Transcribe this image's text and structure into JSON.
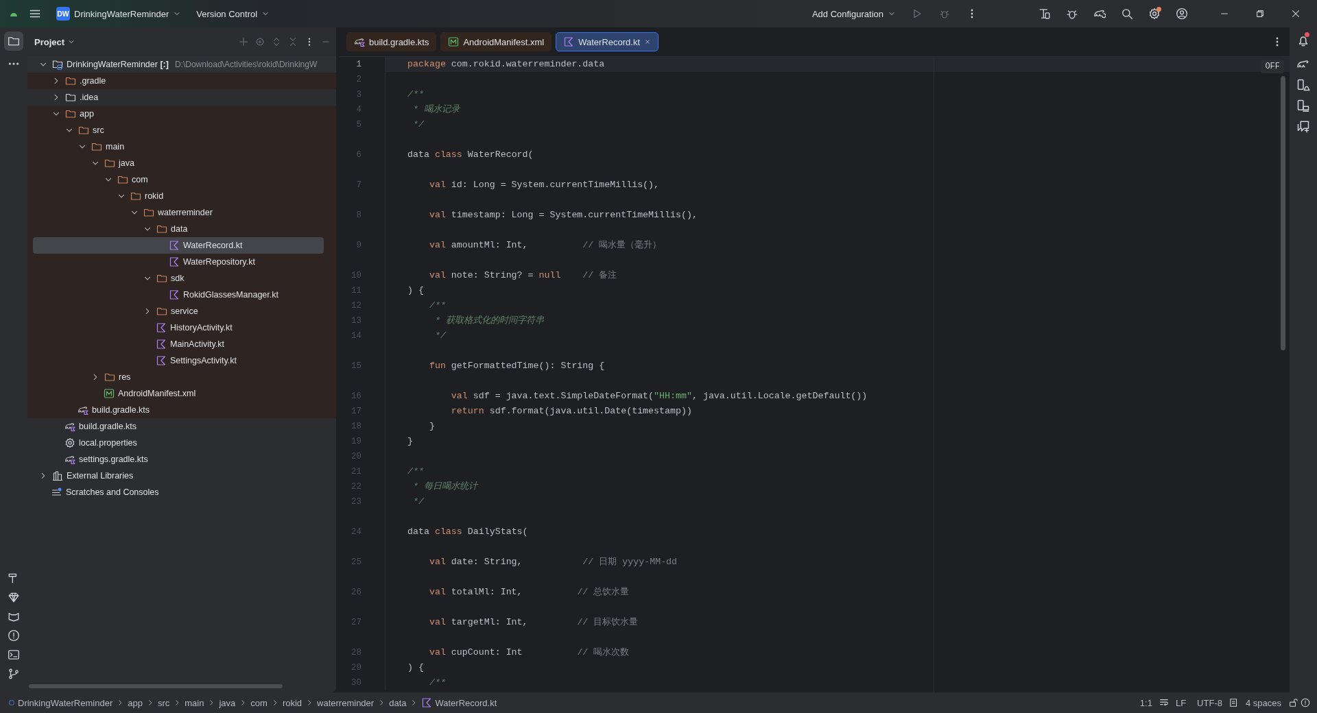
{
  "title_bar": {
    "project_badge": "DW",
    "project_name": "DrinkingWaterReminder",
    "vcs": "Version Control",
    "run_config": "Add Configuration"
  },
  "project_panel": {
    "title": "Project",
    "tree": [
      {
        "label": "DrinkingWaterReminder **[:]**",
        "path": "D:\\Download\\Activities\\rokid\\DrinkingW",
        "kind": "module",
        "expanded": true,
        "tinted": false,
        "selected": false,
        "children": [
          {
            "label": ".gradle",
            "kind": "folder",
            "expanded": false,
            "tinted": true,
            "selected": false
          },
          {
            "label": ".idea",
            "kind": "folder-plain",
            "expanded": false,
            "tinted": false,
            "selected": false
          },
          {
            "label": "app",
            "kind": "folder",
            "expanded": true,
            "tinted": true,
            "selected": false,
            "children": [
              {
                "label": "src",
                "kind": "folder",
                "expanded": true,
                "tinted": true,
                "selected": false,
                "children": [
                  {
                    "label": "main",
                    "kind": "folder",
                    "expanded": true,
                    "tinted": true,
                    "selected": false,
                    "children": [
                      {
                        "label": "java",
                        "kind": "folder",
                        "expanded": true,
                        "tinted": true,
                        "selected": false,
                        "children": [
                          {
                            "label": "com",
                            "kind": "folder",
                            "expanded": true,
                            "tinted": true,
                            "selected": false,
                            "children": [
                              {
                                "label": "rokid",
                                "kind": "folder",
                                "expanded": true,
                                "tinted": true,
                                "selected": false,
                                "children": [
                                  {
                                    "label": "waterreminder",
                                    "kind": "folder",
                                    "expanded": true,
                                    "tinted": true,
                                    "selected": false,
                                    "children": [
                                      {
                                        "label": "data",
                                        "kind": "folder",
                                        "expanded": true,
                                        "tinted": true,
                                        "selected": false,
                                        "children": [
                                          {
                                            "label": "WaterRecord.kt",
                                            "kind": "kotlin",
                                            "tinted": true,
                                            "selected": true
                                          },
                                          {
                                            "label": "WaterRepository.kt",
                                            "kind": "kotlin",
                                            "tinted": true,
                                            "selected": false
                                          }
                                        ]
                                      },
                                      {
                                        "label": "sdk",
                                        "kind": "folder",
                                        "expanded": true,
                                        "tinted": true,
                                        "selected": false,
                                        "children": [
                                          {
                                            "label": "RokidGlassesManager.kt",
                                            "kind": "kotlin",
                                            "tinted": true,
                                            "selected": false
                                          }
                                        ]
                                      },
                                      {
                                        "label": "service",
                                        "kind": "folder",
                                        "expanded": false,
                                        "tinted": true,
                                        "selected": false
                                      },
                                      {
                                        "label": "HistoryActivity.kt",
                                        "kind": "kotlin",
                                        "tinted": true,
                                        "selected": false
                                      },
                                      {
                                        "label": "MainActivity.kt",
                                        "kind": "kotlin",
                                        "tinted": true,
                                        "selected": false
                                      },
                                      {
                                        "label": "SettingsActivity.kt",
                                        "kind": "kotlin",
                                        "tinted": true,
                                        "selected": false
                                      }
                                    ]
                                  }
                                ]
                              }
                            ]
                          }
                        ]
                      },
                      {
                        "label": "res",
                        "kind": "folder",
                        "expanded": false,
                        "tinted": true,
                        "selected": false
                      },
                      {
                        "label": "AndroidManifest.xml",
                        "kind": "manifest",
                        "tinted": true,
                        "selected": false
                      }
                    ]
                  }
                ]
              },
              {
                "label": "build.gradle.kts",
                "kind": "gradle",
                "tinted": true,
                "selected": false
              }
            ]
          },
          {
            "label": "build.gradle.kts",
            "kind": "gradle",
            "tinted": false,
            "selected": false
          },
          {
            "label": "local.properties",
            "kind": "settings",
            "tinted": false,
            "selected": false
          },
          {
            "label": "settings.gradle.kts",
            "kind": "gradle",
            "tinted": false,
            "selected": false
          }
        ]
      },
      {
        "label": "External Libraries",
        "kind": "libraries",
        "expanded": false,
        "tinted": false,
        "selected": false
      },
      {
        "label": "Scratches and Consoles",
        "kind": "scratches",
        "tinted": false,
        "selected": false
      }
    ]
  },
  "tabs": [
    {
      "label": "build.gradle.kts",
      "kind": "gradle",
      "selected": false,
      "tinted": true
    },
    {
      "label": "AndroidManifest.xml",
      "kind": "manifest",
      "selected": false,
      "tinted": true
    },
    {
      "label": "WaterRecord.kt",
      "kind": "kotlin",
      "selected": true,
      "tinted": false
    }
  ],
  "editor": {
    "inspection_badge": "OFF",
    "lines": [
      {
        "n": "1",
        "current": true,
        "spaced": false,
        "tokens": [
          {
            "kind": "kw",
            "t": "package"
          },
          {
            "kind": "p",
            "t": " com.rokid.waterreminder.data"
          }
        ]
      },
      {
        "n": "2",
        "current": false,
        "spaced": false
      },
      {
        "n": "3",
        "current": false,
        "spaced": false,
        "tokens": [
          {
            "kind": "doc",
            "t": "/**"
          }
        ]
      },
      {
        "n": "4",
        "current": false,
        "spaced": false,
        "tokens": [
          {
            "kind": "doc",
            "t": " * 喝水记录"
          }
        ]
      },
      {
        "n": "5",
        "current": false,
        "spaced": false,
        "tokens": [
          {
            "kind": "doc",
            "t": " */"
          }
        ]
      },
      {
        "n": "6",
        "current": false,
        "spaced": true,
        "tokens": [
          {
            "kind": "p",
            "t": "data "
          },
          {
            "kind": "kw",
            "t": "class"
          },
          {
            "kind": "p",
            "t": " WaterRecord("
          }
        ]
      },
      {
        "n": "7",
        "current": false,
        "spaced": true,
        "tokens": [
          {
            "kind": "kw",
            "t": "    val"
          },
          {
            "kind": "p",
            "t": " id: Long = System.currentTimeMillis(),"
          }
        ]
      },
      {
        "n": "8",
        "current": false,
        "spaced": true,
        "tokens": [
          {
            "kind": "kw",
            "t": "    val"
          },
          {
            "kind": "p",
            "t": " timestamp: Long = System.currentTimeMillis(),"
          }
        ]
      },
      {
        "n": "9",
        "current": false,
        "spaced": true,
        "tokens": [
          {
            "kind": "kw",
            "t": "    val"
          },
          {
            "kind": "p",
            "t": " amountMl: Int,          "
          },
          {
            "kind": "cmt",
            "t": "// 喝水量（毫升）"
          }
        ]
      },
      {
        "n": "10",
        "current": false,
        "spaced": true,
        "tokens": [
          {
            "kind": "kw",
            "t": "    val"
          },
          {
            "kind": "p",
            "t": " note: String? = "
          },
          {
            "kind": "kw",
            "t": "null"
          },
          {
            "kind": "cmt",
            "t": "    // 备注"
          }
        ]
      },
      {
        "n": "11",
        "current": false,
        "spaced": false,
        "tokens": [
          {
            "kind": "p",
            "t": ") {"
          }
        ]
      },
      {
        "n": "12",
        "current": false,
        "spaced": false,
        "tokens": [
          {
            "kind": "doc",
            "t": "    /**"
          }
        ]
      },
      {
        "n": "13",
        "current": false,
        "spaced": false,
        "tokens": [
          {
            "kind": "doc",
            "t": "     * 获取格式化的时间字符串"
          }
        ]
      },
      {
        "n": "14",
        "current": false,
        "spaced": false,
        "tokens": [
          {
            "kind": "doc",
            "t": "     */"
          }
        ]
      },
      {
        "n": "15",
        "current": false,
        "spaced": true,
        "tokens": [
          {
            "kind": "kw",
            "t": "    fun"
          },
          {
            "kind": "p",
            "t": " getFormattedTime(): String {"
          }
        ]
      },
      {
        "n": "16",
        "current": false,
        "spaced": true,
        "tokens": [
          {
            "kind": "kw",
            "t": "        val"
          },
          {
            "kind": "p",
            "t": " sdf = java.text.SimpleDateFormat("
          },
          {
            "kind": "str",
            "t": "\"HH:mm\""
          },
          {
            "kind": "p",
            "t": ", java.util.Locale.getDefault())"
          }
        ]
      },
      {
        "n": "17",
        "current": false,
        "spaced": false,
        "tokens": [
          {
            "kind": "kw",
            "t": "        return"
          },
          {
            "kind": "p",
            "t": " sdf.format(java.util.Date(timestamp))"
          }
        ]
      },
      {
        "n": "18",
        "current": false,
        "spaced": false,
        "tokens": [
          {
            "kind": "p",
            "t": "    }"
          }
        ]
      },
      {
        "n": "19",
        "current": false,
        "spaced": false,
        "tokens": [
          {
            "kind": "p",
            "t": "}"
          }
        ]
      },
      {
        "n": "20",
        "current": false,
        "spaced": false
      },
      {
        "n": "21",
        "current": false,
        "spaced": false,
        "tokens": [
          {
            "kind": "doc",
            "t": "/**"
          }
        ]
      },
      {
        "n": "22",
        "current": false,
        "spaced": false,
        "tokens": [
          {
            "kind": "doc",
            "t": " * 每日喝水统计"
          }
        ]
      },
      {
        "n": "23",
        "current": false,
        "spaced": false,
        "tokens": [
          {
            "kind": "doc",
            "t": " */"
          }
        ]
      },
      {
        "n": "24",
        "current": false,
        "spaced": true,
        "tokens": [
          {
            "kind": "p",
            "t": "data "
          },
          {
            "kind": "kw",
            "t": "class"
          },
          {
            "kind": "p",
            "t": " DailyStats("
          }
        ]
      },
      {
        "n": "25",
        "current": false,
        "spaced": true,
        "tokens": [
          {
            "kind": "kw",
            "t": "    val"
          },
          {
            "kind": "p",
            "t": " date: String,           "
          },
          {
            "kind": "cmt",
            "t": "// 日期 yyyy-MM-dd"
          }
        ]
      },
      {
        "n": "26",
        "current": false,
        "spaced": true,
        "tokens": [
          {
            "kind": "kw",
            "t": "    val"
          },
          {
            "kind": "p",
            "t": " totalMl: Int,          "
          },
          {
            "kind": "cmt",
            "t": "// 总饮水量"
          }
        ]
      },
      {
        "n": "27",
        "current": false,
        "spaced": true,
        "tokens": [
          {
            "kind": "kw",
            "t": "    val"
          },
          {
            "kind": "p",
            "t": " targetMl: Int,         "
          },
          {
            "kind": "cmt",
            "t": "// 目标饮水量"
          }
        ]
      },
      {
        "n": "28",
        "current": false,
        "spaced": true,
        "tokens": [
          {
            "kind": "kw",
            "t": "    val"
          },
          {
            "kind": "p",
            "t": " cupCount: Int          "
          },
          {
            "kind": "cmt",
            "t": "// 喝水次数"
          }
        ]
      },
      {
        "n": "29",
        "current": false,
        "spaced": false,
        "tokens": [
          {
            "kind": "p",
            "t": ") {"
          }
        ]
      },
      {
        "n": "30",
        "current": false,
        "spaced": false,
        "tokens": [
          {
            "kind": "doc",
            "t": "    /**"
          }
        ]
      }
    ]
  },
  "status_bar": {
    "breadcrumbs": [
      {
        "label": "DrinkingWaterReminder",
        "kind": "module"
      },
      {
        "label": "app",
        "kind": "folder"
      },
      {
        "label": "src",
        "kind": "folder"
      },
      {
        "label": "main",
        "kind": "folder"
      },
      {
        "label": "java",
        "kind": "folder"
      },
      {
        "label": "com",
        "kind": "folder"
      },
      {
        "label": "rokid",
        "kind": "folder"
      },
      {
        "label": "waterreminder",
        "kind": "folder"
      },
      {
        "label": "data",
        "kind": "folder"
      },
      {
        "label": "WaterRecord.kt",
        "kind": "kotlin"
      }
    ],
    "position": "1:1",
    "line_separator": "LF",
    "encoding": "UTF-8",
    "indent": "4 spaces"
  }
}
